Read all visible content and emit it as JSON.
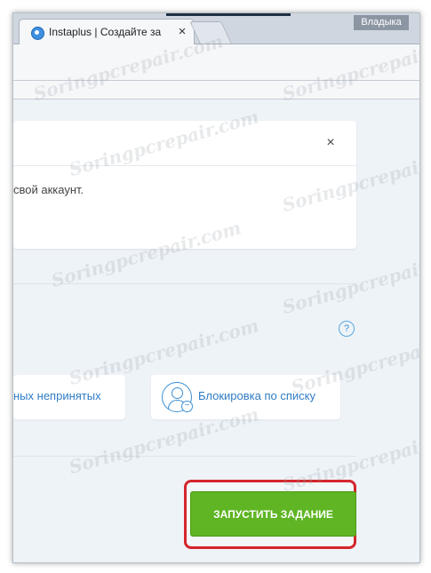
{
  "browser": {
    "tab_title": "Instaplus | Создайте за",
    "tab_close": "×",
    "profile_name": "Владыка"
  },
  "notice": {
    "text": "свой аккаунт.",
    "close": "×"
  },
  "help": {
    "label": "?"
  },
  "options": {
    "left_label": "ных непринятых",
    "right_label": "Блокировка по списку",
    "right_icon": "user-minus-icon"
  },
  "actions": {
    "start_label": "ЗАПУСТИТЬ ЗАДАНИЕ"
  },
  "watermark": "Soringpcrepair.com",
  "colors": {
    "accent": "#3b8fd5",
    "start_button": "#5fb523",
    "highlight": "#d4262c",
    "page_bg": "#eef3f8"
  }
}
